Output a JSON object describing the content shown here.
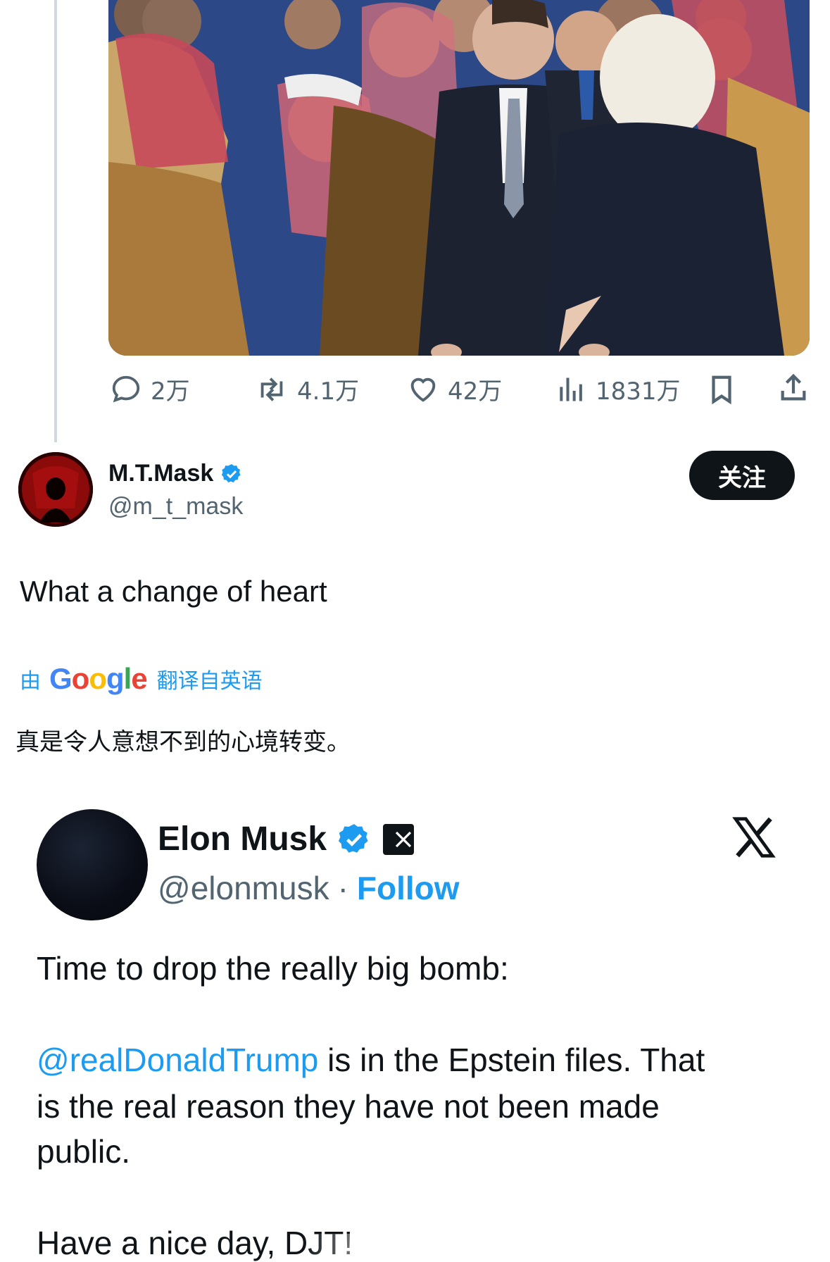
{
  "post_actions": {
    "replies": "2万",
    "reposts": "4.1万",
    "likes": "42万",
    "views": "1831万"
  },
  "author": {
    "name": "M.T.Mask",
    "handle": "@m_t_mask",
    "follow_label": "关注"
  },
  "tweet": {
    "text": "What a change of heart",
    "translation_by": "由",
    "google_logo": "Google",
    "translation_from": "翻译自英语",
    "translated_text": "真是令人意想不到的心境转变。"
  },
  "embedded_post": {
    "name": "Elon Musk",
    "handle": "@elonmusk",
    "separator": "·",
    "follow_label": "Follow",
    "line1": "Time to drop the really big bomb:",
    "mention": "@realDonaldTrump",
    "line2_rest": " is in the Epstein files. That",
    "line3": "is the real reason they have not been made",
    "line4": "public.",
    "line5": "Have a nice day, DJT!"
  },
  "colors": {
    "accent": "#1d9bf0",
    "text": "#0f1419",
    "muted": "#536471",
    "verified": "#1d9bf0"
  },
  "icons": [
    "reply-icon",
    "repost-icon",
    "like-icon",
    "views-icon",
    "bookmark-icon",
    "share-icon",
    "verified-badge-icon",
    "x-logo-icon"
  ]
}
